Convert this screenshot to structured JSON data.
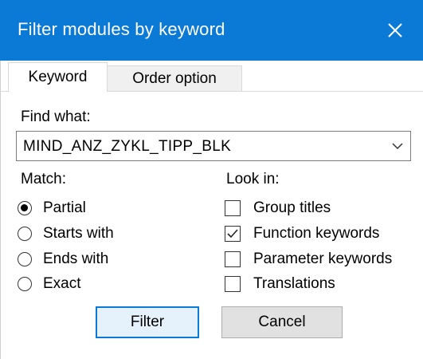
{
  "window": {
    "title": "Filter modules by keyword",
    "close_icon": "close-icon"
  },
  "tabs": [
    {
      "label": "Keyword",
      "active": true
    },
    {
      "label": "Order option",
      "active": false
    }
  ],
  "find": {
    "label": "Find what:",
    "value": "MIND_ANZ_ZYKL_TIPP_BLK",
    "dropdown_icon": "chevron-down-icon"
  },
  "match": {
    "label": "Match:",
    "options": [
      {
        "label": "Partial",
        "selected": true
      },
      {
        "label": "Starts with",
        "selected": false
      },
      {
        "label": "Ends with",
        "selected": false
      },
      {
        "label": "Exact",
        "selected": false
      }
    ]
  },
  "look_in": {
    "label": "Look in:",
    "options": [
      {
        "label": "Group titles",
        "checked": false
      },
      {
        "label": "Function keywords",
        "checked": true
      },
      {
        "label": "Parameter keywords",
        "checked": false
      },
      {
        "label": "Translations",
        "checked": false
      }
    ]
  },
  "buttons": {
    "filter": "Filter",
    "cancel": "Cancel"
  },
  "colors": {
    "accent": "#0a7ad6",
    "button_face": "#e1e1e1",
    "default_button_face": "#e5f1fb"
  }
}
